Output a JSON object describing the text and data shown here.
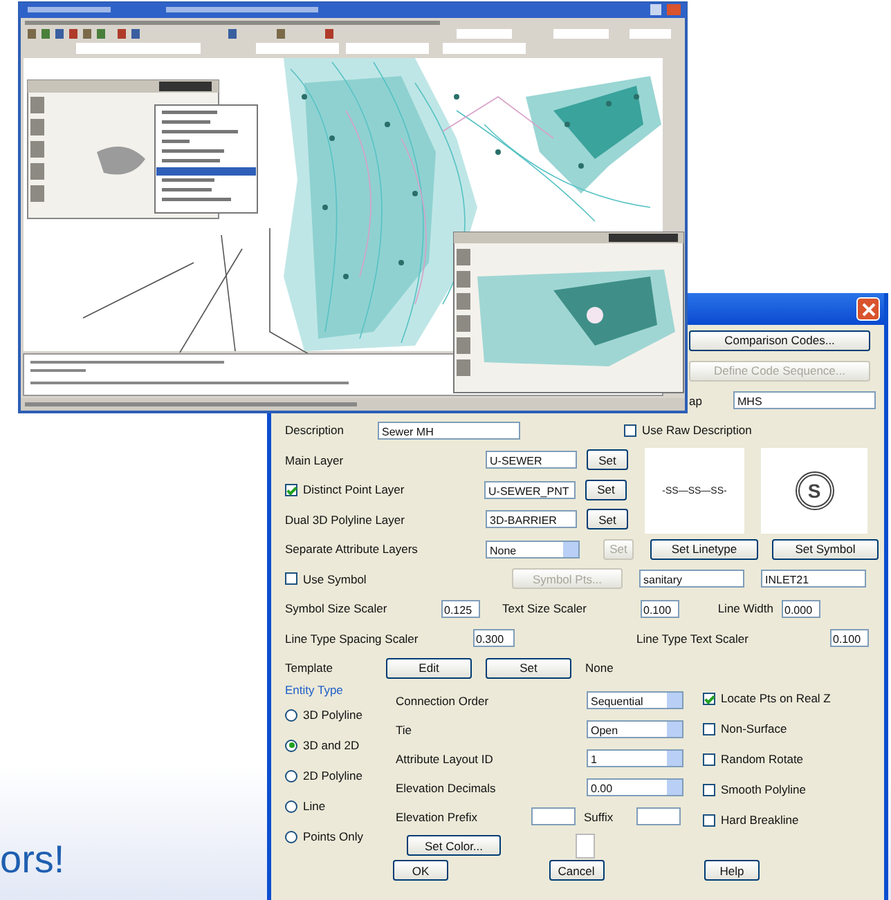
{
  "dialog": {
    "top_buttons": [
      {
        "label": "Comparison Codes...",
        "disabled": false
      },
      {
        "label": "Define Code Sequence...",
        "disabled": true
      }
    ],
    "code_field": {
      "label": "ap",
      "value": "MHS"
    },
    "description": {
      "label": "Description",
      "value": "Sewer MH"
    },
    "use_raw_description": {
      "label": "Use Raw Description",
      "checked": false
    },
    "layers": [
      {
        "kind": "label",
        "label": "Main Layer",
        "value": "U-SEWER",
        "button": "Set"
      },
      {
        "kind": "checkbox",
        "label": "Distinct Point Layer",
        "checked": true,
        "value": "U-SEWER_PNT",
        "button": "Set"
      },
      {
        "kind": "label",
        "label": "Dual 3D Polyline Layer",
        "value": "3D-BARRIER",
        "button": "Set"
      }
    ],
    "linetype_preview": "-SS—SS—SS-",
    "symbol_preview": "S",
    "separate_attribute_layers": {
      "label": "Separate Attribute Layers",
      "value": "None",
      "button": "Set",
      "button_disabled": true
    },
    "set_linetype": "Set Linetype",
    "set_symbol": "Set Symbol",
    "use_symbol": {
      "label": "Use Symbol",
      "checked": false
    },
    "symbol_pts": {
      "label": "Symbol Pts...",
      "disabled": true
    },
    "linetype_name": "sanitary",
    "symbol_name": "INLET21",
    "scalers": [
      {
        "label": "Symbol Size Scaler",
        "value": "0.125"
      },
      {
        "label": "Text Size Scaler",
        "value": "0.100"
      },
      {
        "label": "Line Width",
        "value": "0.000"
      }
    ],
    "scalers_2": [
      {
        "label": "Line Type Spacing Scaler",
        "value": "0.300"
      },
      {
        "label": "Line Type Text Scaler",
        "value": "0.100"
      }
    ],
    "template": {
      "label": "Template",
      "buttons": [
        "Edit",
        "Set"
      ],
      "value": "None"
    },
    "entity_type": {
      "title": "Entity Type",
      "options": [
        {
          "label": "3D Polyline",
          "selected": false
        },
        {
          "label": "3D and 2D",
          "selected": true
        },
        {
          "label": "2D Polyline",
          "selected": false
        },
        {
          "label": "Line",
          "selected": false
        },
        {
          "label": "Points Only",
          "selected": false
        }
      ]
    },
    "settings": [
      {
        "label": "Connection Order",
        "value": "Sequential"
      },
      {
        "label": "Tie",
        "value": "Open"
      },
      {
        "label": "Attribute Layout ID",
        "value": "1"
      },
      {
        "label": "Elevation Decimals",
        "value": "0.00"
      }
    ],
    "elevation_prefix": {
      "label": "Elevation Prefix"
    },
    "suffix": {
      "label": "Suffix"
    },
    "set_color": "Set Color...",
    "options": [
      {
        "label": "Locate Pts on Real Z",
        "checked": true
      },
      {
        "label": "Non-Surface",
        "checked": false
      },
      {
        "label": "Random Rotate",
        "checked": false
      },
      {
        "label": "Smooth Polyline",
        "checked": false
      },
      {
        "label": "Hard Breakline",
        "checked": false
      }
    ],
    "footer_buttons": [
      "OK",
      "Cancel",
      "Help"
    ]
  },
  "tagline": "ors!"
}
